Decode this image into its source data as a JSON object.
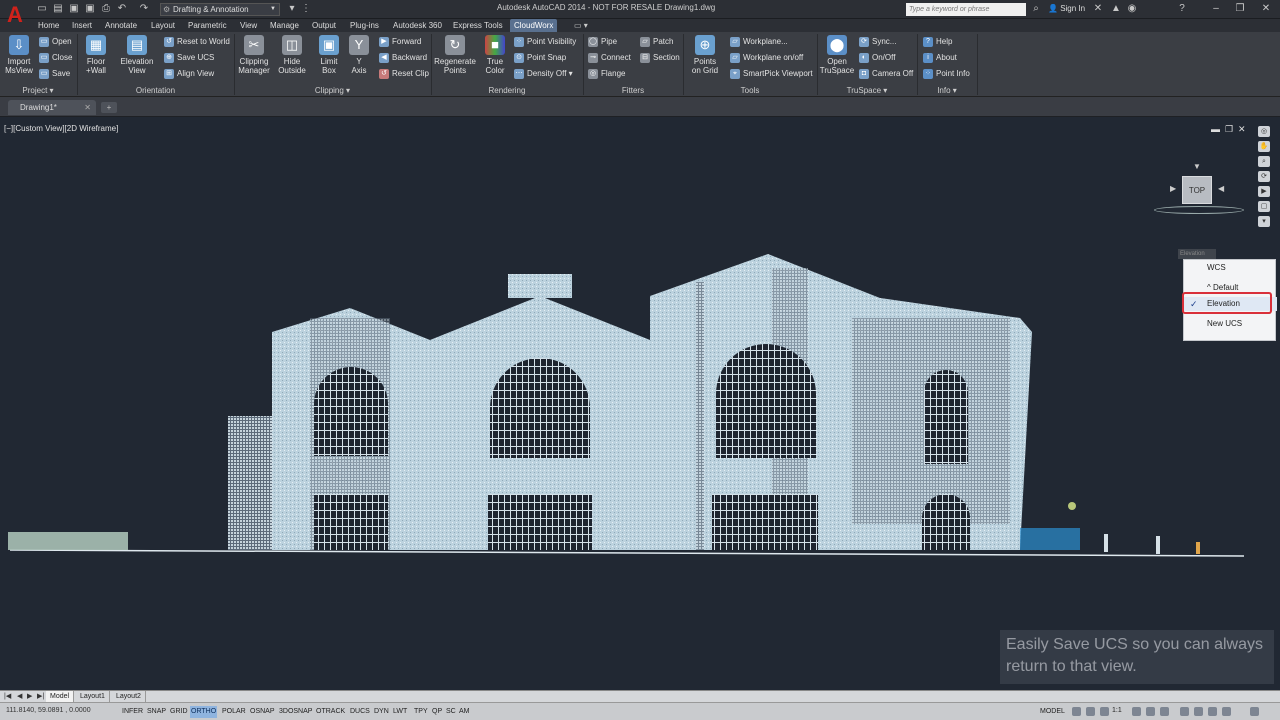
{
  "window": {
    "title": "Autodesk AutoCAD 2014 - NOT FOR RESALE    Drawing1.dwg",
    "workspace": "Drafting & Annotation",
    "search_placeholder": "Type a keyword or phrase",
    "signin": "Sign In"
  },
  "ribbon_tabs": [
    "Home",
    "Insert",
    "Annotate",
    "Layout",
    "Parametric",
    "View",
    "Manage",
    "Output",
    "Plug-ins",
    "Autodesk 360",
    "Express Tools",
    "CloudWorx"
  ],
  "active_tab": "CloudWorx",
  "panels": {
    "project": {
      "title": "Project",
      "import": "Import\nMsView",
      "open": "Open",
      "close": "Close",
      "save": "Save"
    },
    "orientation": {
      "title": "Orientation",
      "floor_wall": "Floor\n+Wall",
      "elevation_view": "Elevation\nView",
      "reset_world": "Reset to World",
      "save_ucs": "Save UCS",
      "align_view": "Align View"
    },
    "clipping": {
      "title": "Clipping",
      "clipping_manager": "Clipping\nManager",
      "hide_outside": "Hide\nOutside",
      "limit_box": "Limit\nBox",
      "y_axis": "Y\nAxis",
      "forward": "Forward",
      "backward": "Backward",
      "reset_clip": "Reset Clip"
    },
    "rendering": {
      "title": "Rendering",
      "regenerate": "Regenerate\nPoints",
      "true_color": "True\nColor",
      "point_visibility": "Point Visibility",
      "point_snap": "Point Snap",
      "density_off": "Density Off"
    },
    "fitters": {
      "title": "Fitters",
      "pipe": "Pipe",
      "connect": "Connect",
      "flange": "Flange",
      "patch": "Patch",
      "section": "Section"
    },
    "tools": {
      "title": "Tools",
      "points_on_grid": "Points\non Grid",
      "workplane": "Workplane...",
      "workplane_onoff": "Workplane on/off",
      "smartpick": "SmartPick Viewport"
    },
    "truspace": {
      "title": "TruSpace",
      "open_truspace": "Open\nTruSpace",
      "sync": "Sync...",
      "onoff": "On/Off",
      "camera_off": "Camera Off"
    },
    "info": {
      "title": "Info",
      "help": "Help",
      "about": "About",
      "point_info": "Point Info"
    }
  },
  "file_tab": "Drawing1*",
  "viewport": {
    "label": "[−][Custom View][2D Wireframe]",
    "viewcube_face": "TOP",
    "ucs_label": "Elevation",
    "ucs_menu": [
      "WCS",
      "^ Default",
      "Elevation",
      "New UCS"
    ],
    "ucs_selected": "Elevation",
    "caption": "Easily Save UCS so you can always return to that view."
  },
  "layout_tabs": [
    "Model",
    "Layout1",
    "Layout2"
  ],
  "status": {
    "coords": "111.8140, 59.0891 , 0.0000",
    "toggles": [
      "INFER",
      "SNAP",
      "GRID",
      "ORTHO",
      "POLAR",
      "OSNAP",
      "3DOSNAP",
      "OTRACK",
      "DUCS",
      "DYN",
      "LWT",
      "TPY",
      "QP",
      "SC",
      "AM"
    ],
    "on_toggles": [
      "ORTHO"
    ],
    "model": "MODEL",
    "scale": "1:1"
  },
  "colors": {
    "viewport_bg": "#212833",
    "ribbon_bg": "#3b3e44",
    "active_tab": "#59708f",
    "highlight": "#d9303a",
    "point_cloud": "#c6dbe6"
  }
}
